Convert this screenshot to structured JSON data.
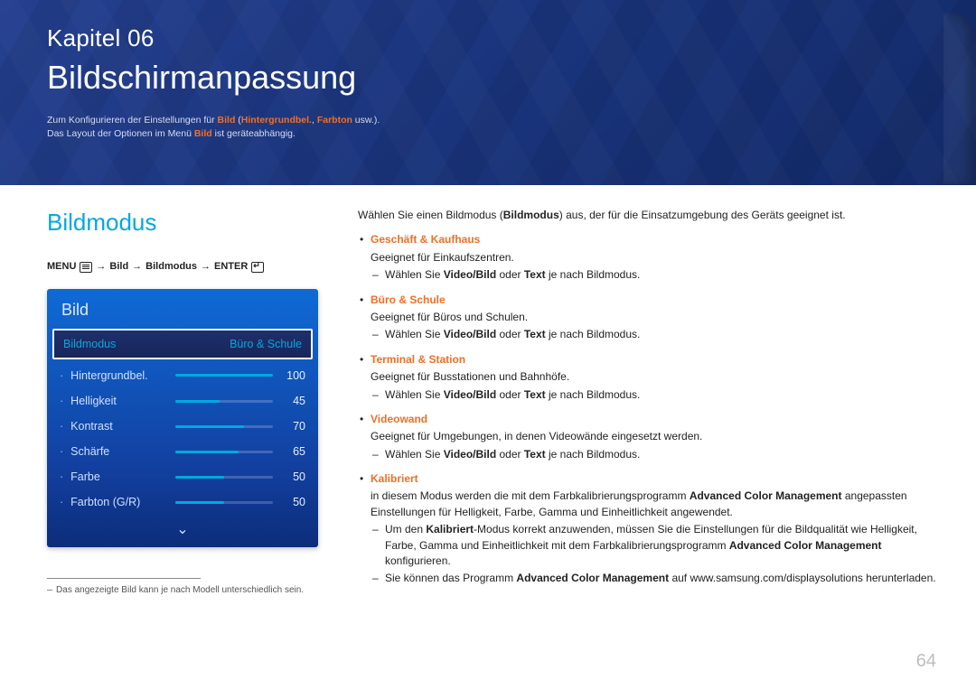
{
  "page_number": "64",
  "banner": {
    "chapter_label": "Kapitel 06",
    "chapter_title": "Bildschirmanpassung",
    "intro_prefix": "Zum Konfigurieren der Einstellungen für ",
    "intro_hl1": "Bild",
    "intro_paren_open": " (",
    "intro_hl2": "Hintergrundbel.",
    "intro_comma": ", ",
    "intro_hl3": "Farbton",
    "intro_paren_close": " usw.).",
    "intro2_prefix": "Das Layout der Optionen im Menü ",
    "intro2_hl": "Bild",
    "intro2_suffix": " ist geräteabhängig."
  },
  "left": {
    "section_title": "Bildmodus",
    "breadcrumb": {
      "menu": "MENU",
      "step1": "Bild",
      "step2": "Bildmodus",
      "enter": "ENTER"
    },
    "osd": {
      "title": "Bild",
      "selected_key": "Bildmodus",
      "selected_value": "Büro & Schule",
      "rows": [
        {
          "label": "Hintergrundbel.",
          "value": 100,
          "pct": 100
        },
        {
          "label": "Helligkeit",
          "value": 45,
          "pct": 45
        },
        {
          "label": "Kontrast",
          "value": 70,
          "pct": 70
        },
        {
          "label": "Schärfe",
          "value": 65,
          "pct": 65
        },
        {
          "label": "Farbe",
          "value": 50,
          "pct": 50
        },
        {
          "label": "Farbton (G/R)",
          "value": 50,
          "pct": 50
        }
      ]
    },
    "foot_hint": "Das angezeigte Bild kann je nach Modell unterschiedlich sein."
  },
  "right": {
    "lead_prefix": "Wählen Sie einen Bildmodus (",
    "lead_bold": "Bildmodus",
    "lead_suffix": ") aus, der für die Einsatzumgebung des Geräts geeignet ist.",
    "modes": [
      {
        "name": "Geschäft & Kaufhaus",
        "desc": "Geeignet für Einkaufszentren.",
        "sub": [
          {
            "pre": "Wählen Sie ",
            "b1": "Video/Bild",
            "mid": " oder ",
            "b2": "Text",
            "post": " je nach Bildmodus."
          }
        ]
      },
      {
        "name": "Büro & Schule",
        "desc": "Geeignet für Büros und Schulen.",
        "sub": [
          {
            "pre": "Wählen Sie ",
            "b1": "Video/Bild",
            "mid": " oder ",
            "b2": "Text",
            "post": " je nach Bildmodus."
          }
        ]
      },
      {
        "name": "Terminal & Station",
        "desc": "Geeignet für Busstationen und Bahnhöfe.",
        "sub": [
          {
            "pre": "Wählen Sie ",
            "b1": "Video/Bild",
            "mid": " oder ",
            "b2": "Text",
            "post": " je nach Bildmodus."
          }
        ]
      },
      {
        "name": "Videowand",
        "desc": "Geeignet für Umgebungen, in denen Videowände eingesetzt werden.",
        "sub": [
          {
            "pre": "Wählen Sie ",
            "b1": "Video/Bild",
            "mid": " oder ",
            "b2": "Text",
            "post": " je nach Bildmodus."
          }
        ]
      },
      {
        "name": "Kalibriert",
        "desc_rich": {
          "pre": "in diesem Modus werden die mit dem Farbkalibrierungsprogramm ",
          "b": "Advanced Color Management",
          "post": " angepassten Einstellungen für Helligkeit, Farbe, Gamma und Einheitlichkeit angewendet."
        },
        "sub_rich": [
          {
            "parts": [
              {
                "t": "Um den "
              },
              {
                "b": "Kalibriert"
              },
              {
                "t": "-Modus korrekt anzuwenden, müssen Sie die Einstellungen für die Bildqualität wie Helligkeit, Farbe, Gamma und Einheitlichkeit mit dem Farbkalibrierungsprogramm "
              },
              {
                "b": "Advanced Color Management"
              },
              {
                "t": " konfigurieren."
              }
            ]
          },
          {
            "parts": [
              {
                "t": "Sie können das Programm "
              },
              {
                "b": "Advanced Color Management"
              },
              {
                "t": " auf www.samsung.com/displaysolutions herunterladen."
              }
            ]
          }
        ]
      }
    ]
  }
}
